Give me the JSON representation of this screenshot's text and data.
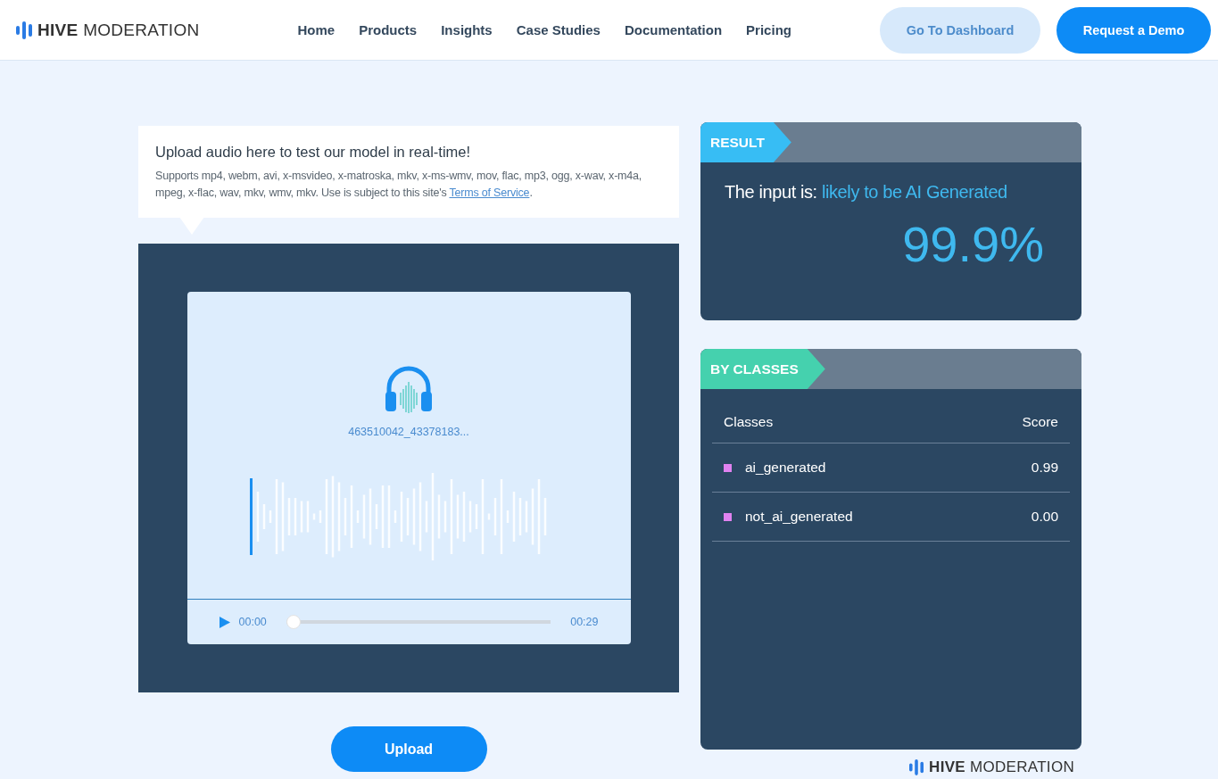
{
  "header": {
    "logo": "**HIVE** MODERATION",
    "nav": [
      "Home",
      "Products",
      "Insights",
      "Case Studies",
      "Documentation",
      "Pricing"
    ],
    "buttons": [
      {
        "label": "Go To Dashboard",
        "kind": "secondary"
      },
      {
        "label": "Request a Demo",
        "kind": "primary"
      }
    ]
  },
  "intro": {
    "title": "Upload audio here to test our model in real-time!",
    "text": "Supports mp4, webm, avi, x-msvideo, x-matroska, mkv, x-ms-wmv, mov, flac, mp3, ogg, x-wav, x-m4a, mpeg, x-flac, wav, mkv, wmv, mkv. Use is subject to this site's ",
    "link": "Terms of Service",
    "after": "."
  },
  "player": {
    "filename": "463510042_43378183...",
    "current": "00:00",
    "level": 0,
    "duration": "00:29"
  },
  "upload_button": "Upload",
  "result": {
    "tag": "RESULT",
    "label": "The input is:",
    "verdict": "likely to be AI Generated",
    "score": "99.9%"
  },
  "classes": {
    "tag": "BY CLASSES",
    "columns": [
      "Classes",
      "Score"
    ],
    "rows": [
      {
        "name": "ai_generated",
        "score": "0.99",
        "color": "#e082f0"
      },
      {
        "name": "not_ai_generated",
        "score": "0.00",
        "color": "#e082f0"
      }
    ]
  },
  "footer_logo": "**HIVE** MODERATION"
}
